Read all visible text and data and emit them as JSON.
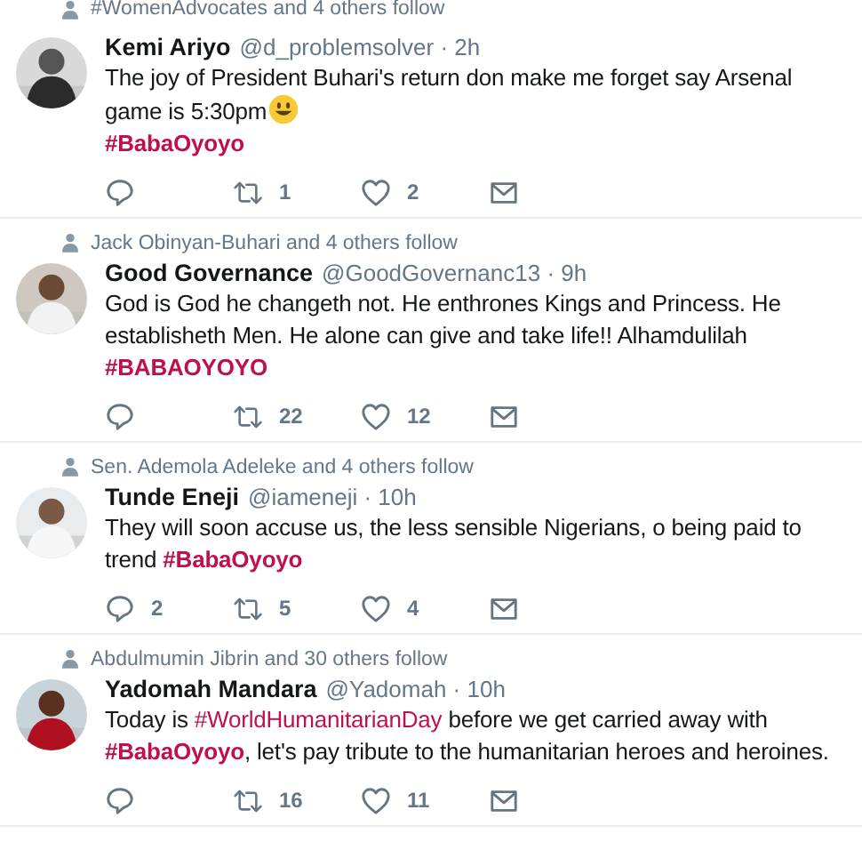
{
  "top_context": "#WomenAdvocates and 4 others follow",
  "tweets": [
    {
      "name": "Kemi Ariyo",
      "handle": "@d_problemsolver · 2h",
      "avatar": {
        "kind": "picture"
      },
      "text": [
        {
          "kind": "plain",
          "t": "The joy of President Buhari's return don make me forget say Arsenal game is 5:30pm"
        },
        {
          "kind": "emoji"
        },
        {
          "kind": "break"
        },
        {
          "kind": "match",
          "t": "#BabaOyoyo"
        }
      ],
      "retweets": "1",
      "likes": "2"
    },
    {
      "context": "Jack Obinyan-Buhari and 4 others follow",
      "name": "Good Governance",
      "handle": "@GoodGovernanc13 · 9h",
      "avatar": {
        "kind": "picture"
      },
      "text": [
        {
          "kind": "plain",
          "t": "God is God he changeth not. He enthrones Kings and Princess. He establisheth Men. He alone can give and take life!! Alhamdulilah"
        },
        {
          "kind": "break"
        },
        {
          "kind": "match",
          "t": "#BABAOYOYO"
        }
      ],
      "retweets": "22",
      "likes": "12"
    },
    {
      "context": "Sen. Ademola Adeleke and 4 others follow",
      "name": "Tunde Eneji",
      "handle": "@iameneji · 10h",
      "avatar": {
        "kind": "picture"
      },
      "text": [
        {
          "kind": "plain",
          "t": "They will soon accuse us, the less sensible Nigerians, o being paid to trend "
        },
        {
          "kind": "match",
          "t": "#BabaOyoyo"
        }
      ],
      "replies": "2",
      "retweets": "5",
      "likes": "4"
    },
    {
      "context": "Abdulmumin Jibrin and 30 others follow",
      "name": "Yadomah Mandara",
      "handle": "@Yadomah · 10h",
      "avatar": {
        "kind": "picture"
      },
      "text": [
        {
          "kind": "plain",
          "t": "Today is "
        },
        {
          "kind": "hashtag",
          "t": "#WorldHumanitarianDay"
        },
        {
          "kind": "plain",
          "t": " before we get carried away with "
        },
        {
          "kind": "match",
          "t": "#BabaOyoyo"
        },
        {
          "kind": "plain",
          "t": ", let's pay tribute to the humanitarian heroes and heroines."
        }
      ],
      "retweets": "16",
      "likes": "11"
    }
  ]
}
